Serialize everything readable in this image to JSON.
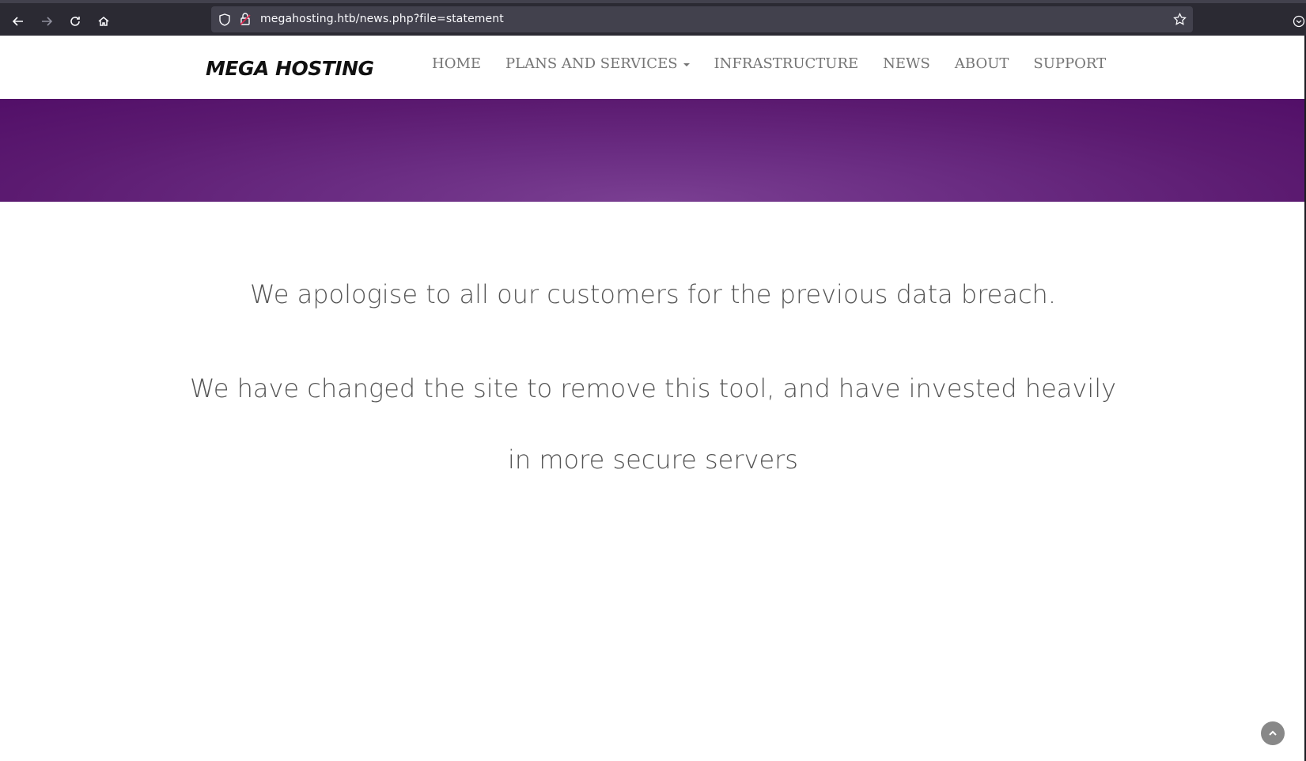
{
  "browser": {
    "url": "megahosting.htb/news.php?file=statement",
    "icons": [
      "back-arrow-icon",
      "forward-arrow-icon",
      "reload-icon",
      "home-icon",
      "shield-icon",
      "lock-icon",
      "star-icon",
      "extension-icon"
    ]
  },
  "site": {
    "logo": "MEGA HOSTING",
    "nav": [
      {
        "label": "HOME"
      },
      {
        "label": "PLANS AND SERVICES",
        "has_dropdown": true
      },
      {
        "label": "INFRASTRUCTURE"
      },
      {
        "label": "NEWS"
      },
      {
        "label": "ABOUT"
      },
      {
        "label": "SUPPORT"
      }
    ],
    "hero_color": "#6a2c82"
  },
  "statement": {
    "line1": "We apologise to all our customers for the previous data breach.",
    "line2": "We have changed the site to remove this tool, and have invested heavily",
    "line3": "in more secure servers"
  }
}
